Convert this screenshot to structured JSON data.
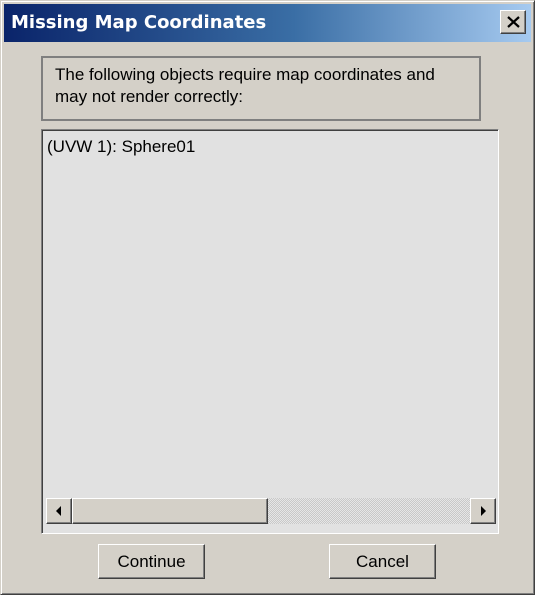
{
  "window": {
    "title": "Missing Map Coordinates"
  },
  "message": {
    "text": "The following objects require map coordinates and may not render correctly:"
  },
  "list": {
    "items": [
      {
        "label": "(UVW 1): Sphere01"
      }
    ]
  },
  "scrollbar": {
    "position_fraction": 0.0,
    "visible_fraction": 0.5
  },
  "buttons": {
    "continue_label": "Continue",
    "cancel_label": "Cancel"
  },
  "icons": {
    "close": "close-icon",
    "left_arrow": "arrow-left-icon",
    "right_arrow": "arrow-right-icon"
  },
  "colors": {
    "titlebar_start": "#0a246a",
    "titlebar_end": "#a6caf0",
    "dialog_background": "#d4d0c8",
    "list_background": "#e1e1e1"
  }
}
